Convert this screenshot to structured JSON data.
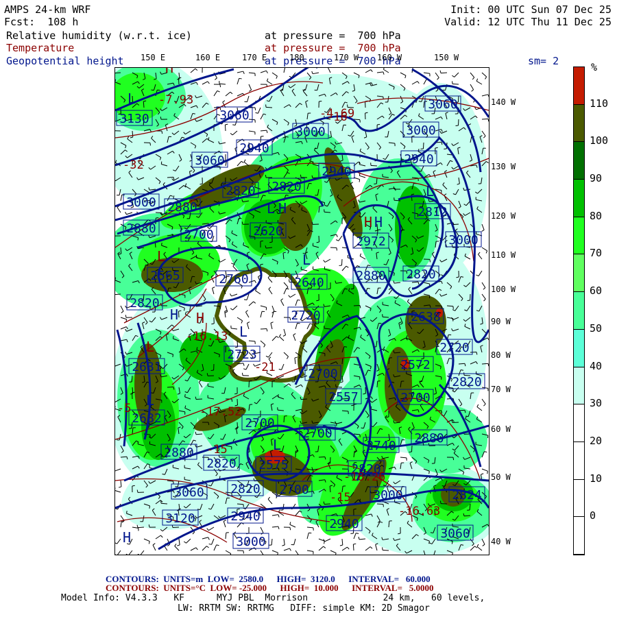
{
  "header": {
    "model": "AMPS 24-km WRF",
    "forecast": "Fcst:  108 h",
    "init": "Init: 00 UTC Sun 07 Dec 25",
    "valid": "Valid: 12 UTC Thu 11 Dec 25"
  },
  "fields": [
    {
      "name": "Relative humidity (w.r.t. ice)",
      "level": "at pressure =  700 hPa"
    },
    {
      "name": "Temperature",
      "level": "at pressure =  700 hPa"
    },
    {
      "name": "Geopotential height",
      "level": "at pressure =  700 hPa"
    }
  ],
  "smoothing": "sm= 2",
  "top_longitudes": [
    "150 E",
    "160 E",
    "170 E",
    "180",
    "170 W",
    "160 W",
    "150 W"
  ],
  "right_longitudes": [
    "140 W",
    "130 W",
    "120 W",
    "110 W",
    "100 W",
    "90 W",
    "80 W",
    "70 W",
    "60 W",
    "50 W",
    "40 W"
  ],
  "colorbar": {
    "unit": "%",
    "labels": [
      "110",
      "100",
      "90",
      "80",
      "70",
      "60",
      "50",
      "40",
      "30",
      "20",
      "10",
      "0"
    ],
    "colors": [
      "#c41c00",
      "#4b5a00",
      "#007000",
      "#00c000",
      "#20ff20",
      "#60ff60",
      "#48ff98",
      "#5cffd8",
      "#c8fff0",
      "#ffffff",
      "#ffffff",
      "#ffffff",
      "#ffffff"
    ]
  },
  "height_labels": [
    "3130",
    "3060",
    "3000",
    "2940",
    "3060",
    "2940",
    "3060",
    "3000",
    "2940",
    "2820",
    "2820",
    "3000",
    "2880",
    "2880",
    "2700",
    "2620",
    "2972",
    "2812",
    "3000",
    "2565",
    "2760",
    "2640",
    "2880",
    "2820",
    "2820",
    "2720",
    "2723",
    "2631",
    "2682",
    "2880",
    "2820",
    "2700",
    "2575",
    "2700",
    "3060",
    "2820",
    "2700",
    "3120",
    "2940",
    "3000",
    "2638",
    "2720",
    "2572",
    "2820",
    "2700",
    "2557",
    "2700",
    "2740",
    "2880",
    "2820",
    "3000",
    "2824",
    "2940",
    "3060"
  ],
  "extrema_labels": [
    "L",
    "H",
    "L",
    "H",
    "H",
    "H",
    "L",
    "L",
    "L",
    "L",
    "L",
    "L",
    "H",
    "H",
    "L",
    "H"
  ],
  "temperature_labels": [
    "-7.93",
    "-4.69",
    "-16",
    "-17.52",
    "-15",
    "-16.13",
    "-18.26",
    "-21",
    "-5",
    "-15",
    "-16.63",
    "-32"
  ],
  "footer": {
    "height_contours": "CONTOURS:  UNITS=m  LOW=  2580.0      HIGH=  3120.0      INTERVAL=   60.000",
    "temp_contours": "CONTOURS:  UNITS=°C  LOW= -25.000      HIGH=  10.000      INTERVAL=   5.0000",
    "model_info": "Model Info: V4.3.3   KF      MYJ PBL  Morrison              24 km,   60 levels,",
    "physics": "LW: RRTM SW: RRTMG   DIFF: simple KM: 2D Smagor"
  }
}
